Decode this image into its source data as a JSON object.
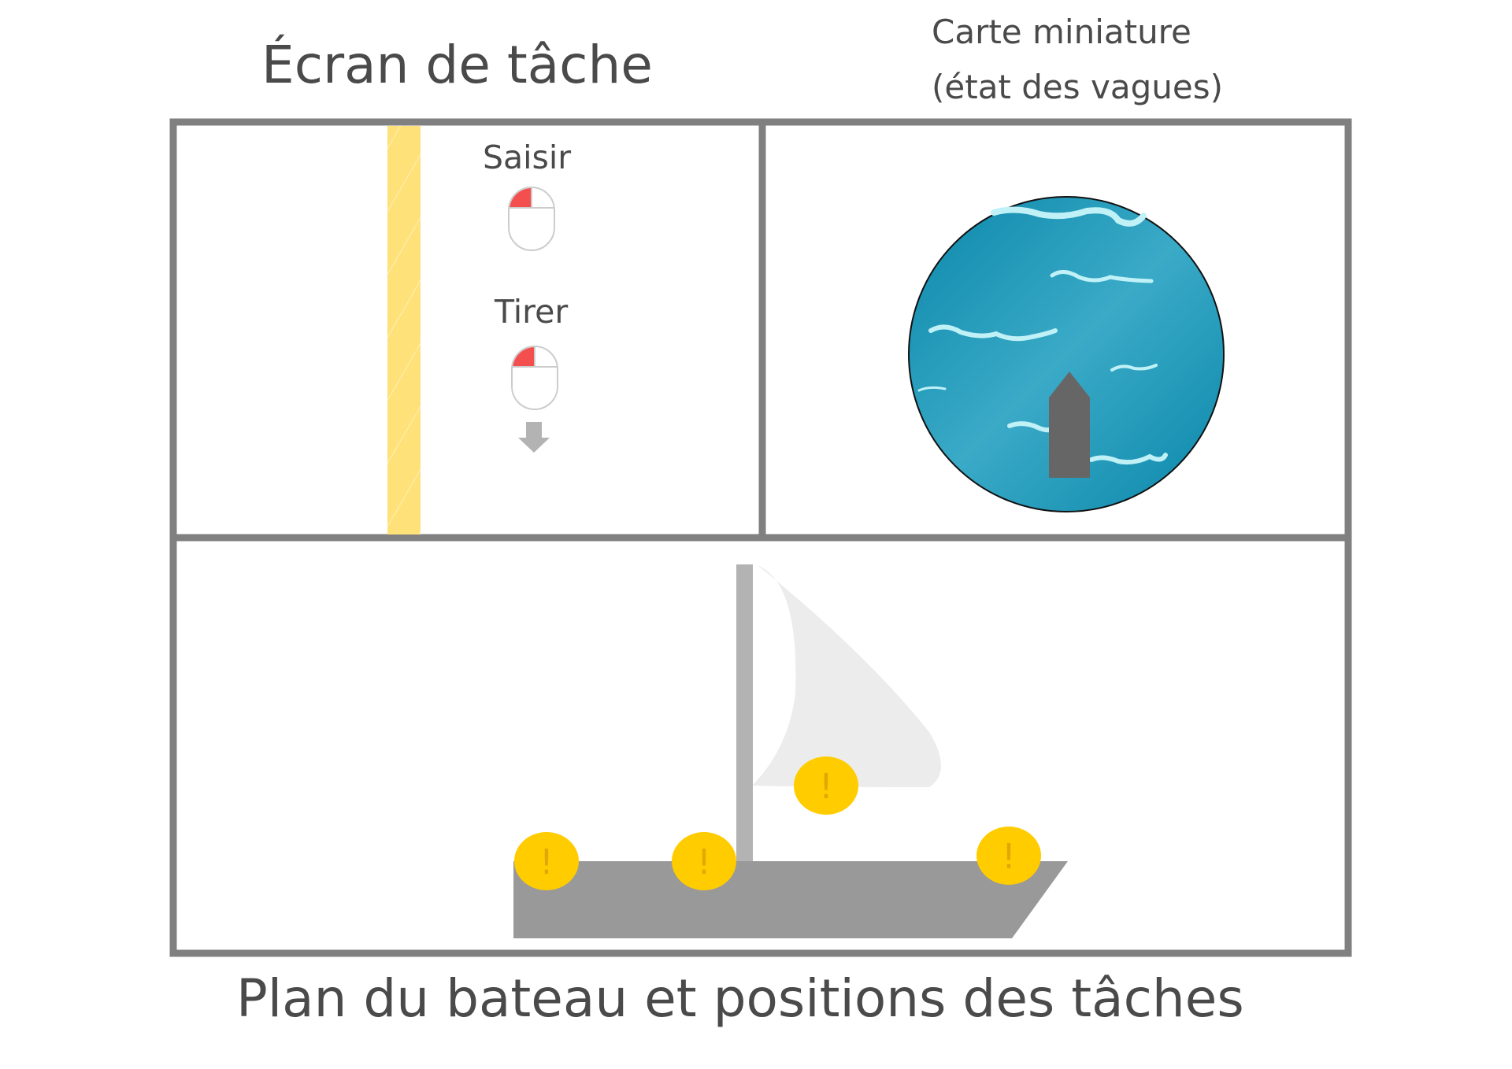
{
  "titles": {
    "task_screen": "Écran de tâche",
    "minimap_line1": "Carte miniature",
    "minimap_line2": "(état des vagues)",
    "boat_plan": "Plan du bateau et positions des tâches"
  },
  "task_panel": {
    "grab_label": "Saisir",
    "pull_label": "Tirer",
    "grab_icon": "mouse-left-click-icon",
    "pull_icon": "mouse-left-click-icon",
    "pull_direction_icon": "arrow-down-icon"
  },
  "boat": {
    "task_markers": [
      {
        "symbol": "!"
      },
      {
        "symbol": "!"
      },
      {
        "symbol": "!"
      },
      {
        "symbol": "!"
      }
    ]
  },
  "colors": {
    "frame": "#808080",
    "text": "#4a4a4a",
    "rope": "#ffe17a",
    "mouse_button": "#f44f4f",
    "sea_dark": "#0b87aa",
    "sea_light": "#3aaac7",
    "wave_foam": "#bff1f7",
    "boat_hull": "#999999",
    "boat_mast": "#b3b3b3",
    "sail": "#ececec",
    "marker": "#ffcc00",
    "marker_text": "#e0a800",
    "minimap_ship": "#666666"
  }
}
